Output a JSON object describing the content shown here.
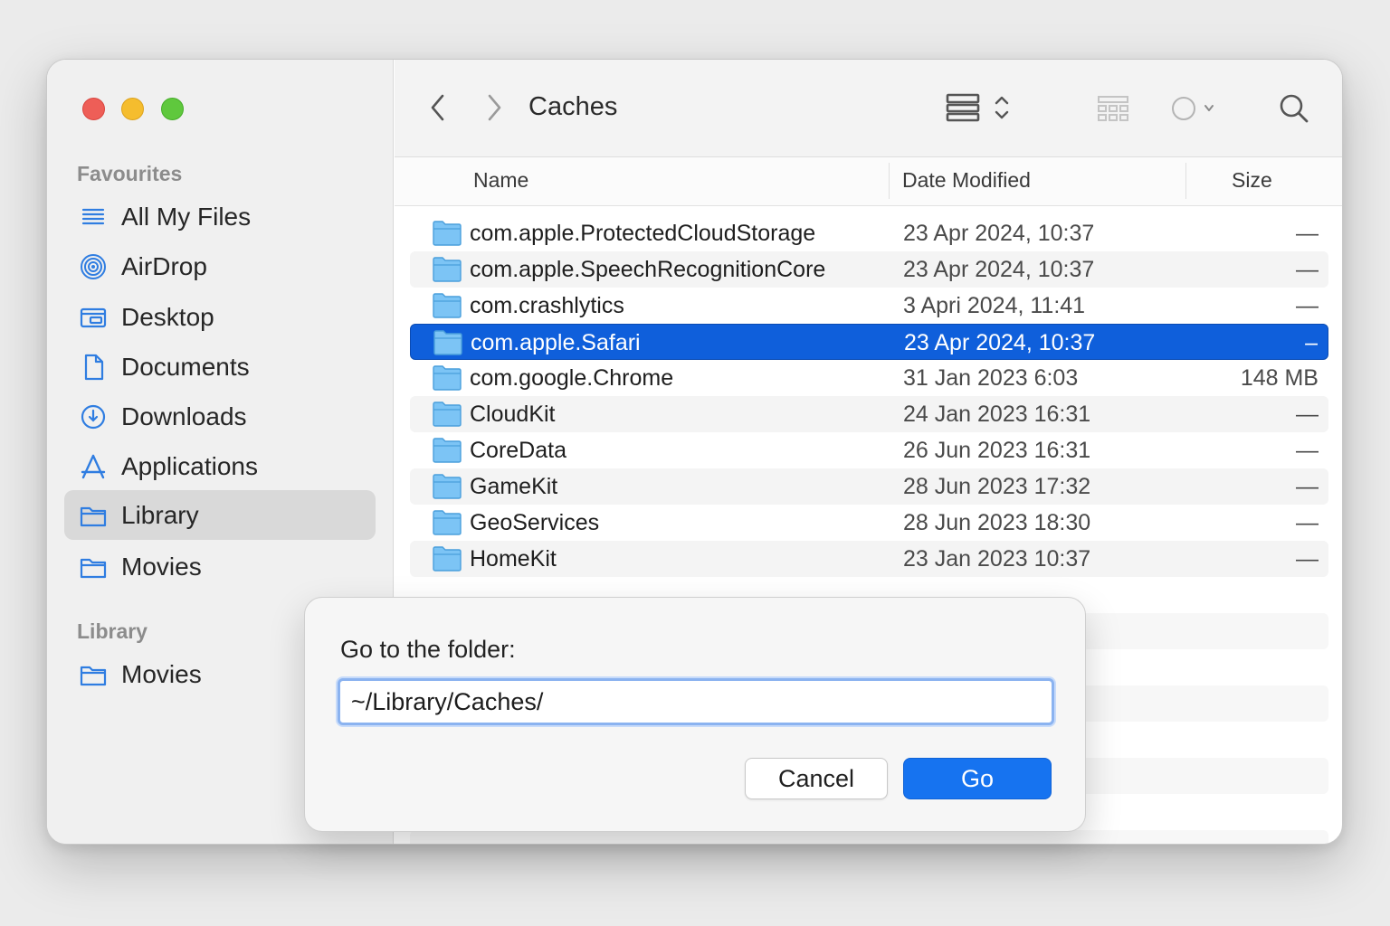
{
  "window": {
    "title": "Caches"
  },
  "sidebar": {
    "favourites_heading": "Favourites",
    "items": [
      {
        "label": "All My Files",
        "icon": "list-icon"
      },
      {
        "label": "AirDrop",
        "icon": "airdrop-icon"
      },
      {
        "label": "Desktop",
        "icon": "desktop-icon"
      },
      {
        "label": "Documents",
        "icon": "document-icon"
      },
      {
        "label": "Downloads",
        "icon": "downloads-icon"
      },
      {
        "label": "Applications",
        "icon": "applications-icon"
      },
      {
        "label": "Library",
        "icon": "folder-icon",
        "selected": true
      },
      {
        "label": "Movies",
        "icon": "folder-icon"
      }
    ],
    "library_heading": "Library",
    "library_items": [
      {
        "label": "Movies",
        "icon": "folder-icon"
      }
    ]
  },
  "toolbar": {
    "back_icon": "chevron-left-icon",
    "forward_icon": "chevron-right-icon",
    "view_icon": "list-view-icon",
    "group_icon": "group-by-icon",
    "tag_icon": "tag-circle-icon",
    "search_icon": "search-icon"
  },
  "columns": {
    "name": "Name",
    "date": "Date Modified",
    "size": "Size"
  },
  "files": [
    {
      "name": "com.apple.ProtectedCloudStorage",
      "date": "23 Apr 2024, 10:37",
      "size": "—"
    },
    {
      "name": "com.apple.SpeechRecognitionCore",
      "date": "23 Apr 2024, 10:37",
      "size": "—"
    },
    {
      "name": "com.crashlytics",
      "date": "3 Apri 2024, 11:41",
      "size": "—"
    },
    {
      "name": "com.apple.Safari",
      "date": "23 Apr 2024, 10:37",
      "size": "–",
      "selected": true
    },
    {
      "name": "com.google.Chrome",
      "date": "31 Jan 2023 6:03",
      "size": "148 MB"
    },
    {
      "name": "CloudKit",
      "date": "24 Jan 2023 16:31",
      "size": "—"
    },
    {
      "name": "CoreData",
      "date": "26 Jun 2023 16:31",
      "size": "—"
    },
    {
      "name": "GameKit",
      "date": "28 Jun 2023 17:32",
      "size": "—"
    },
    {
      "name": "GeoServices",
      "date": "28 Jun 2023 18:30",
      "size": "—"
    },
    {
      "name": "HomeKit",
      "date": "23 Jan 2023 10:37",
      "size": "—"
    }
  ],
  "dialog": {
    "prompt": "Go to the folder:",
    "path_value": "~/Library/Caches/",
    "cancel_label": "Cancel",
    "go_label": "Go"
  },
  "colors": {
    "selection": "#0f5fdb",
    "accent": "#1673f0",
    "folder": "#7cc4f5",
    "close": "#ee5e57",
    "minimize": "#f5bd2e",
    "zoom": "#5fc83d"
  }
}
